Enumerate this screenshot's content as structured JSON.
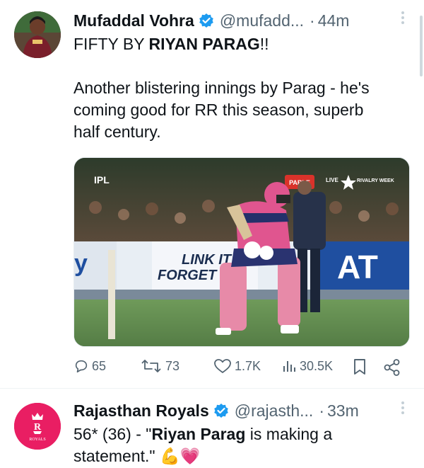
{
  "tweets": [
    {
      "name": "Mufaddal Vohra",
      "handle": "@mufadd...",
      "time": "44m",
      "lines": [
        {
          "a": "FIFTY BY ",
          "b": "RIYAN PARAG",
          "c": "!!"
        },
        {
          "a": "Another blistering innings by Parag - he's"
        },
        {
          "a": "coming good for RR this season, superb"
        },
        {
          "a": "half century."
        }
      ],
      "media": {
        "ipl_logo": "IPL",
        "sponsor": "PARLE",
        "live": "LIVE",
        "rivalry": "RIVALRY WEEK",
        "board_text_1": "LINK IT",
        "board_text_2": "FORGET",
        "board_at": "AT",
        "board_y": "y"
      },
      "stats": {
        "replies": "65",
        "retweets": "73",
        "likes": "1.7K",
        "views": "30.5K"
      }
    },
    {
      "name": "Rajasthan Royals",
      "handle": "@rajasth...",
      "time": "33m",
      "avatar_text": "ROYALS",
      "line1_a": "56* (36) - \"",
      "line1_b": "Riyan Parag",
      "line1_c": " is making a",
      "line2": "statement.\"",
      "emoji": "💪💗"
    }
  ],
  "colors": {
    "verified": "#1d9bf0",
    "rr_pink": "#e91e63",
    "text": "#0f1419",
    "muted": "#536471"
  }
}
